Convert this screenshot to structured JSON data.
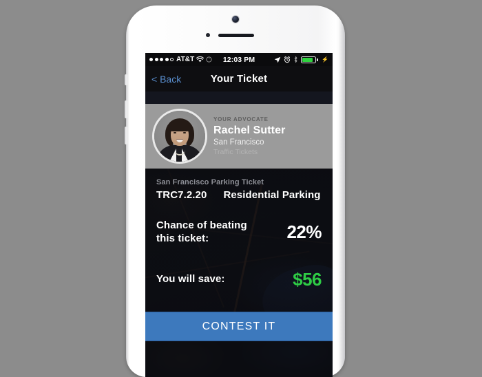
{
  "status_bar": {
    "signal_dots_filled": 4,
    "signal_dots_total": 5,
    "carrier": "AT&T",
    "wifi_icon": "wifi-icon",
    "rotation_lock_icon": "rotation-lock-icon",
    "time": "12:03 PM",
    "location_icon": "location-arrow-icon",
    "alarm_icon": "alarm-clock-icon",
    "bluetooth_icon": "bluetooth-icon",
    "battery_icon": "battery-icon",
    "battery_level_percent": 82,
    "charging_icon": "lightning-bolt-icon",
    "battery_color": "#2fd23f"
  },
  "nav_bar": {
    "back_label": "< Back",
    "back_chevron": "chevron-left-icon",
    "title": "Your Ticket",
    "back_color": "#5a8fd0"
  },
  "advocate": {
    "label": "YOUR ADVOCATE",
    "name": "Rachel Sutter",
    "city": "San Francisco",
    "practice_area": "Traffic Tickets",
    "avatar_icon": "advocate-photo",
    "card_background": "#9b9b9b"
  },
  "ticket": {
    "jurisdiction": "San Francisco Parking Ticket",
    "code": "TRC7.2.20",
    "violation": "Residential Parking",
    "chance_label_line1": "Chance of beating",
    "chance_label_line2": "this ticket:",
    "chance_value": "22%",
    "savings_label": "You will save:",
    "savings_value": "$56",
    "savings_color": "#2ecc45"
  },
  "actions": {
    "contest_label": "CONTEST IT",
    "contest_color": "#3d79bd"
  }
}
